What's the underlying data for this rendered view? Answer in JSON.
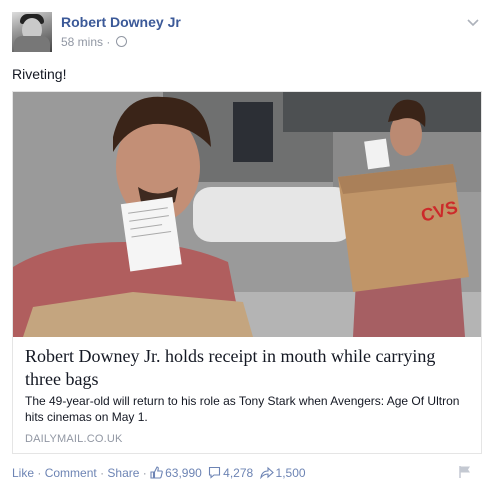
{
  "post": {
    "author": "Robert Downey Jr",
    "time": "58 mins",
    "meta_sep": "·",
    "privacy_icon": "globe-icon",
    "message": "Riveting!"
  },
  "link_card": {
    "headline": "Robert Downey Jr. holds receipt in mouth while carrying three bags",
    "summary": "The 49-year-old will return to his role as Tony Stark when Avengers: Age Of Ultron hits cinemas on May 1.",
    "source": "DAILYMAIL.CO.UK",
    "bag_logo": "CVS"
  },
  "actions": {
    "like": "Like",
    "comment": "Comment",
    "share": "Share",
    "sep": "·",
    "likes_count": "63,990",
    "comments_count": "4,278",
    "shares_count": "1,500"
  },
  "colors": {
    "link_blue": "#3b5998",
    "action_blue": "#6d84b4",
    "meta_gray": "#9197a3"
  }
}
